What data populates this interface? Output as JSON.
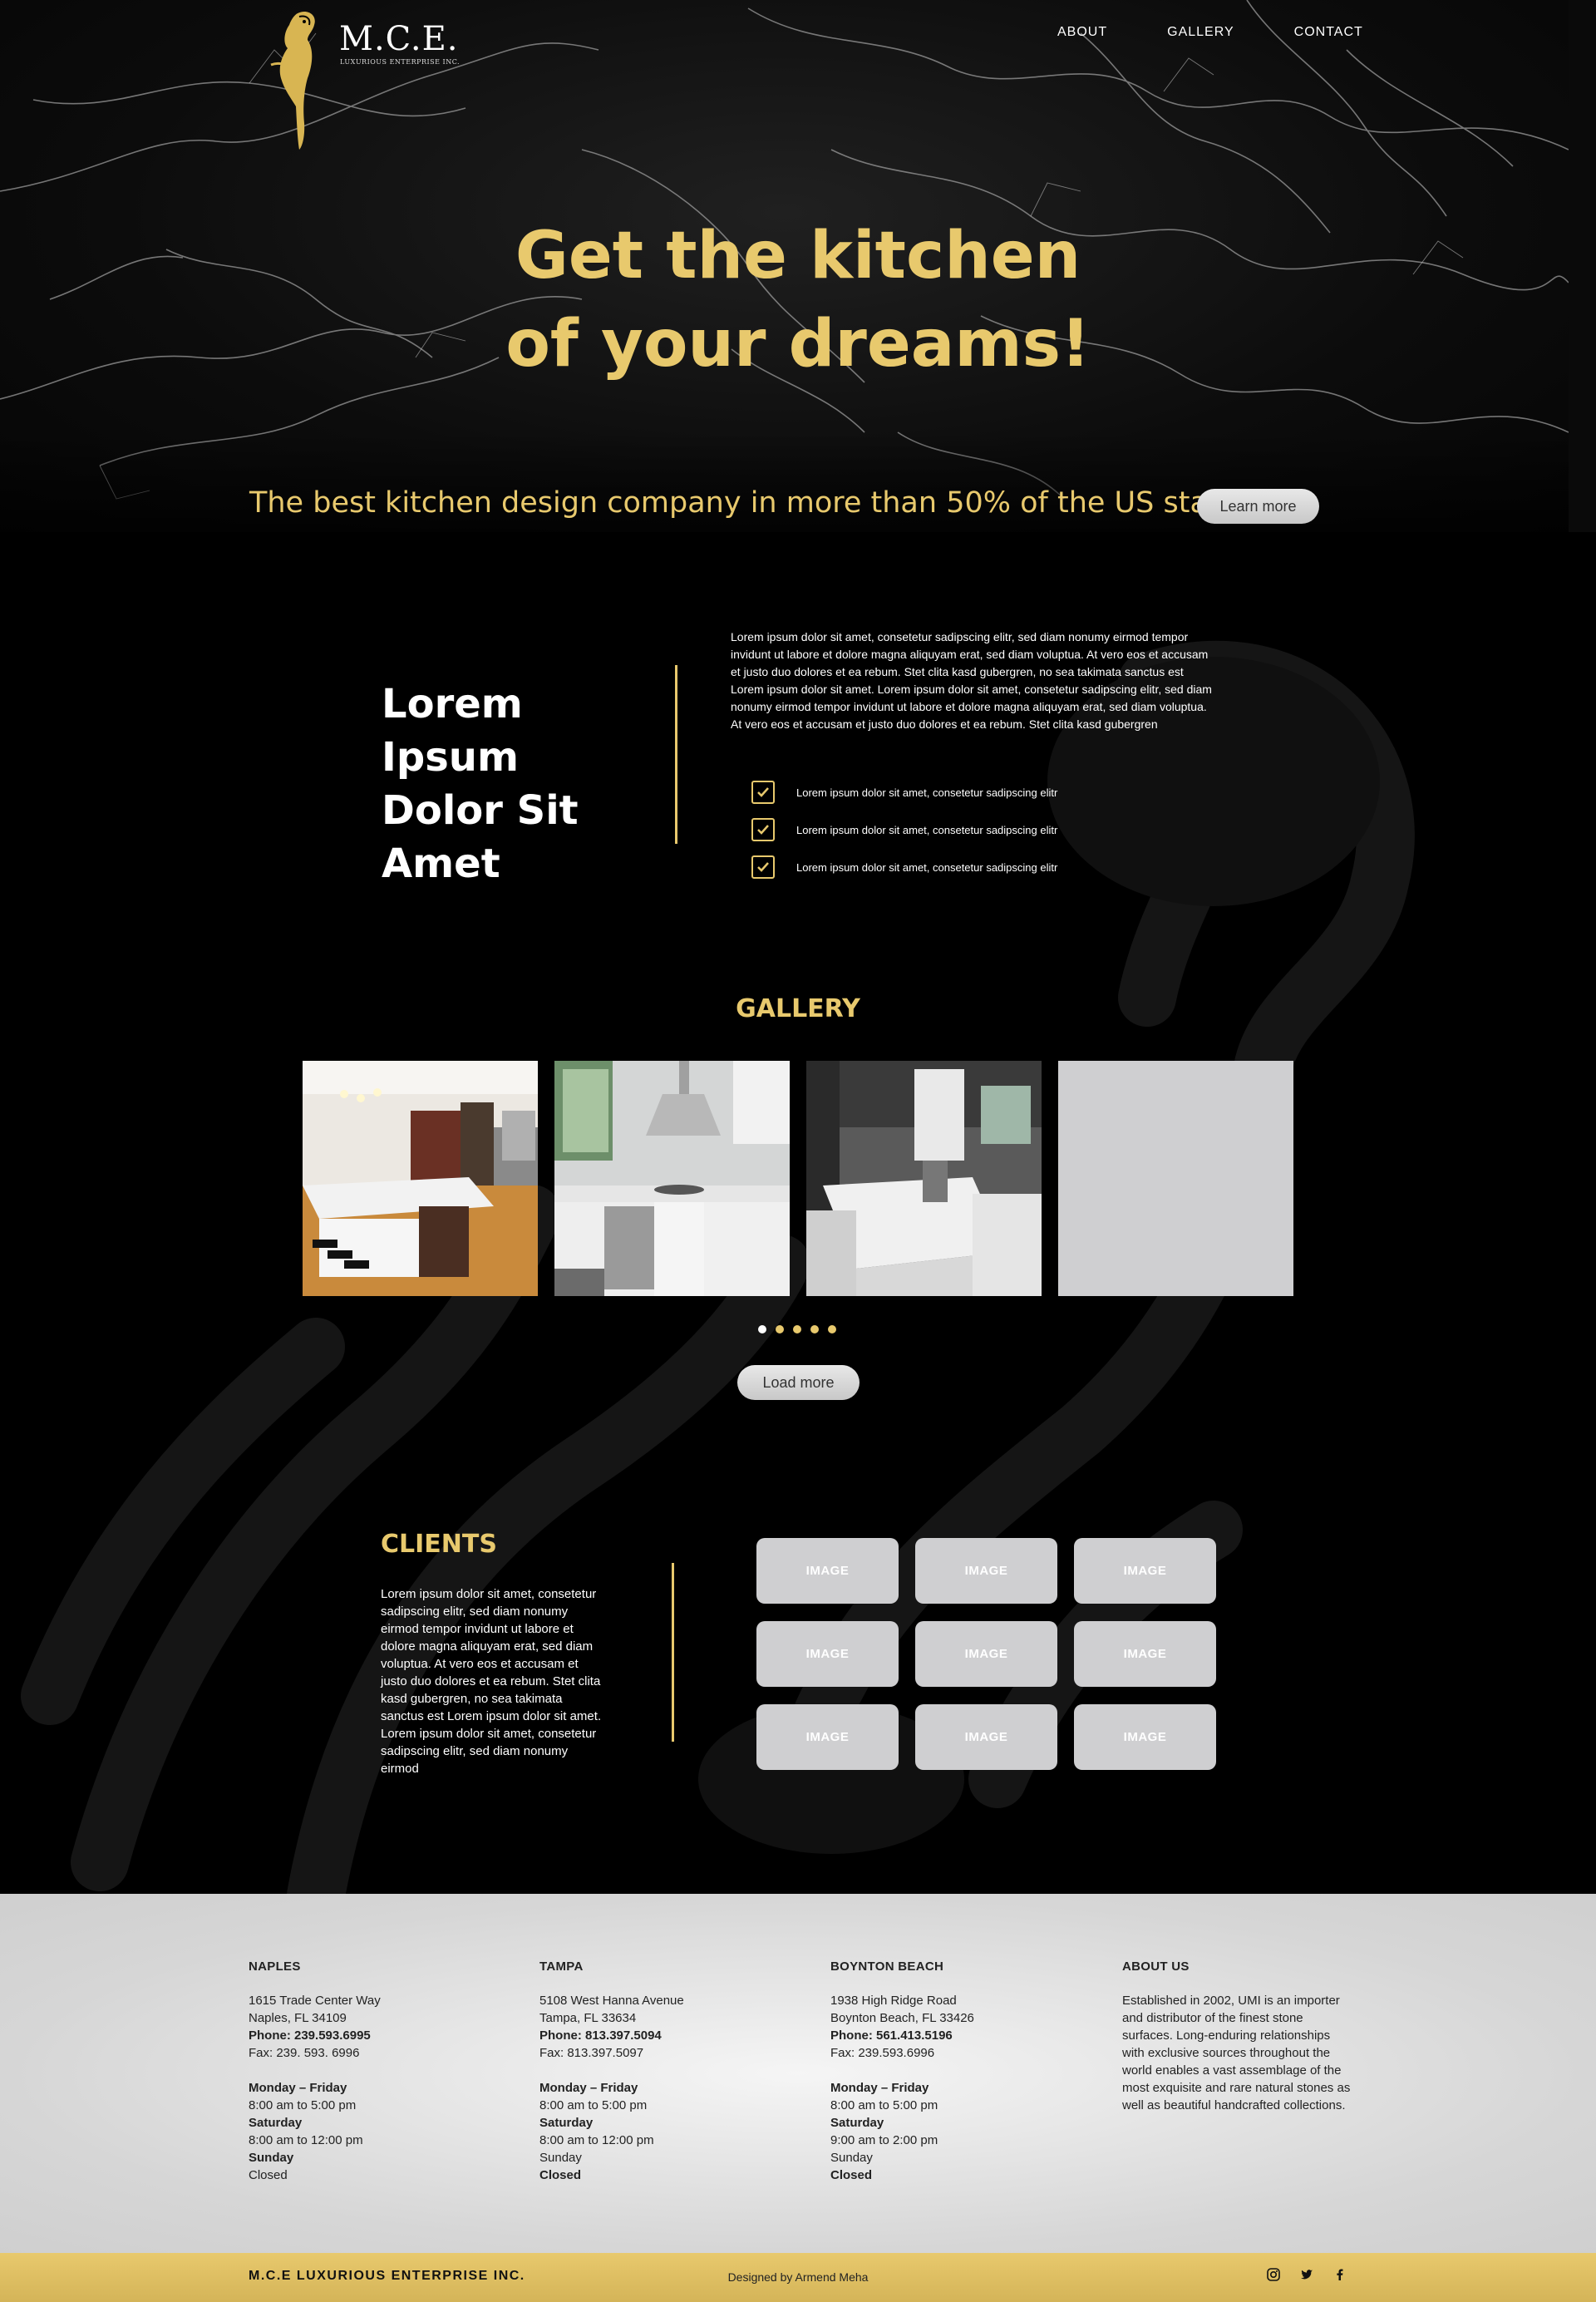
{
  "brand": {
    "name": "M.C.E.",
    "subtitle": "LUXURIOUS ENTERPRISE INC."
  },
  "nav": {
    "items": [
      {
        "label": "ABOUT"
      },
      {
        "label": "GALLERY"
      },
      {
        "label": "CONTACT"
      }
    ]
  },
  "hero": {
    "title_line1": "Get the kitchen",
    "title_line2": "of your dreams!",
    "tagline": "The best kitchen design company in more than 50% of the US states",
    "cta_label": "Learn more"
  },
  "about": {
    "heading_line1": "Lorem Ipsum",
    "heading_line2": "Dolor Sit",
    "heading_line3": "Amet",
    "paragraph": "Lorem ipsum dolor sit amet, consetetur sadipscing elitr, sed diam nonumy eirmod tempor invidunt ut labore et dolore magna aliquyam erat, sed diam voluptua. At vero eos et accusam et justo duo dolores et ea rebum. Stet clita kasd gubergren, no sea takimata sanctus est Lorem ipsum dolor sit amet. Lorem ipsum dolor sit amet, consetetur sadipscing elitr, sed diam nonumy eirmod tempor invidunt ut labore et dolore magna aliquyam erat, sed diam voluptua. At vero eos et accusam et justo duo dolores et ea rebum. Stet clita kasd gubergren",
    "checklist": [
      "Lorem ipsum dolor sit amet, consetetur sadipscing elitr",
      "Lorem ipsum dolor sit amet, consetetur sadipscing elitr",
      "Lorem ipsum dolor sit amet, consetetur sadipscing elitr"
    ]
  },
  "gallery": {
    "title": "GALLERY",
    "dots_count": 5,
    "active_dot": 0,
    "load_more_label": "Load more"
  },
  "clients": {
    "title": "CLIENTS",
    "paragraph": "Lorem ipsum dolor sit amet, consetetur sadipscing elitr, sed diam nonumy eirmod tempor invidunt ut labore et dolore magna aliquyam erat, sed diam voluptua. At vero eos et accusam et justo duo dolores et ea rebum. Stet clita kasd gubergren, no sea takimata sanctus est Lorem ipsum dolor sit amet. Lorem ipsum dolor sit amet, consetetur sadipscing elitr, sed diam nonumy eirmod",
    "logos": [
      "IMAGE",
      "IMAGE",
      "IMAGE",
      "IMAGE",
      "IMAGE",
      "IMAGE",
      "IMAGE",
      "IMAGE",
      "IMAGE"
    ]
  },
  "footer": {
    "locations": [
      {
        "name": "NAPLES",
        "address1": "1615 Trade Center Way",
        "address2": "Naples, FL 34109",
        "phone": "Phone: 239.593.6995",
        "fax": "Fax: 239. 593. 6996",
        "hours": [
          "Monday – Friday",
          "8:00 am to 5:00 pm",
          "Saturday",
          "8:00 am to 12:00 pm",
          "Sunday",
          "Closed"
        ]
      },
      {
        "name": "TAMPA",
        "address1": "5108 West Hanna Avenue",
        "address2": "Tampa, FL 33634",
        "phone": "Phone: 813.397.5094",
        "fax": "Fax: 813.397.5097",
        "hours": [
          "Monday – Friday",
          "8:00 am to 5:00 pm",
          "Saturday",
          "8:00 am to 12:00 pm",
          "Sunday",
          "Closed"
        ]
      },
      {
        "name": "BOYNTON BEACH",
        "address1": "1938 High Ridge Road",
        "address2": "Boynton Beach, FL 33426",
        "phone": "Phone: 561.413.5196",
        "fax": "Fax: 239.593.6996",
        "hours": [
          "Monday – Friday",
          "8:00 am to 5:00 pm",
          "Saturday",
          "9:00 am to 2:00 pm",
          "Sunday",
          "Closed"
        ]
      }
    ],
    "about_title": "ABOUT US",
    "about_text": "Established in 2002, UMI is an importer and distributor of the finest stone surfaces. Long-enduring relationships with exclusive sources throughout the world enables a vast assemblage of the most exquisite and rare natural stones as well as beautiful handcrafted collections.",
    "company": "M.C.E LUXURIOUS ENTERPRISE INC.",
    "designer": "Designed by Armend Meha",
    "social": [
      "instagram-icon",
      "twitter-icon",
      "facebook-icon"
    ]
  },
  "colors": {
    "gold": "#e8c96d",
    "placeholder_gray": "#cfcfd1",
    "footer_bg": "#d6d6d6"
  }
}
